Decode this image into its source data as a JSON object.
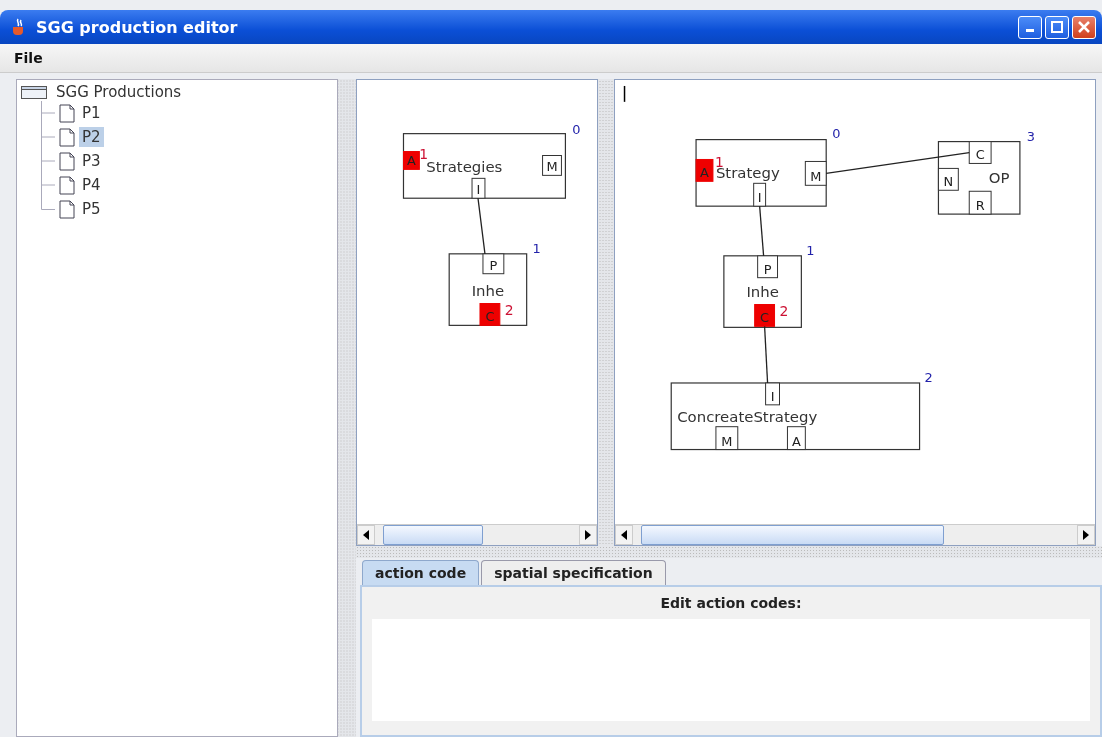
{
  "window": {
    "title": "SGG production editor"
  },
  "menu": [
    "File"
  ],
  "tree": {
    "label": "SGG Productions",
    "expanded": true,
    "children": [
      {
        "label": "P1",
        "selected": false
      },
      {
        "label": "P2",
        "selected": true
      },
      {
        "label": "P3",
        "selected": false
      },
      {
        "label": "P4",
        "selected": false
      },
      {
        "label": "P5",
        "selected": false
      }
    ]
  },
  "canvases": [
    {
      "nodes": [
        {
          "index": "0",
          "name": "Strategies",
          "ports": [
            {
              "label": "A",
              "highlighted": true,
              "number": "1"
            },
            {
              "label": "M",
              "highlighted": false
            },
            {
              "label": "I",
              "highlighted": false
            }
          ]
        },
        {
          "index": "1",
          "name": "Inhe",
          "ports": [
            {
              "label": "P",
              "highlighted": false
            },
            {
              "label": "C",
              "highlighted": true,
              "number": "2"
            }
          ]
        }
      ]
    },
    {
      "nodes": [
        {
          "index": "0",
          "name": "Strategy",
          "ports": [
            {
              "label": "A",
              "highlighted": true,
              "number": "1"
            },
            {
              "label": "M",
              "highlighted": false
            },
            {
              "label": "I",
              "highlighted": false
            }
          ]
        },
        {
          "index": "3",
          "name": "OP",
          "ports": [
            {
              "label": "C",
              "highlighted": false
            },
            {
              "label": "N",
              "highlighted": false
            },
            {
              "label": "R",
              "highlighted": false
            }
          ]
        },
        {
          "index": "1",
          "name": "Inhe",
          "ports": [
            {
              "label": "P",
              "highlighted": false
            },
            {
              "label": "C",
              "highlighted": true,
              "number": "2"
            }
          ]
        },
        {
          "index": "2",
          "name": "ConcreateStrategy",
          "ports": [
            {
              "label": "I",
              "highlighted": false
            },
            {
              "label": "M",
              "highlighted": false
            },
            {
              "label": "A",
              "highlighted": false
            }
          ]
        }
      ]
    }
  ],
  "tabs": [
    {
      "label": "action code",
      "selected": true
    },
    {
      "label": "spatial specification",
      "selected": false
    }
  ],
  "action_panel": {
    "heading": "Edit action codes:"
  }
}
